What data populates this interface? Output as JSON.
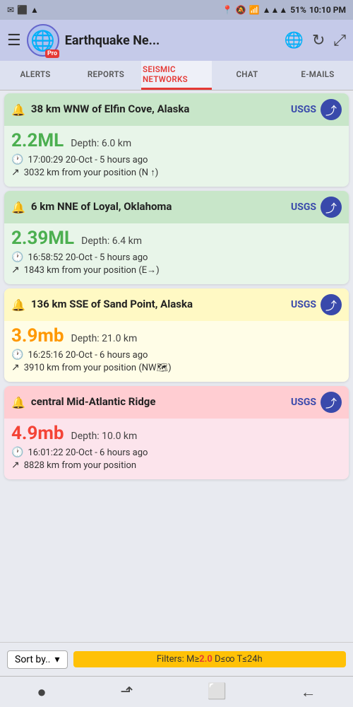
{
  "statusBar": {
    "leftIcons": [
      "✉",
      "⬛",
      "▲"
    ],
    "signal": "▲▲▲",
    "battery": "51%",
    "time": "10:10 PM"
  },
  "header": {
    "menuIcon": "☰",
    "appName": "Earthquake Ne...",
    "proBadge": "Pro",
    "globeIcon": "🌐",
    "refreshIcon": "↻",
    "expandIcon": "⤢"
  },
  "tabs": [
    {
      "id": "alerts",
      "label": "ALERTS",
      "active": false
    },
    {
      "id": "reports",
      "label": "REPORTS",
      "active": false
    },
    {
      "id": "seismic",
      "label": "SEISMIC NETWORKS",
      "active": true
    },
    {
      "id": "chat",
      "label": "CHAT",
      "active": false
    },
    {
      "id": "emails",
      "label": "E-MAILS",
      "active": false
    }
  ],
  "earthquakes": [
    {
      "id": "eq1",
      "location": "38 km WNW of Elfin Cove, Alaska",
      "source": "USGS",
      "magnitude": "2.2ML",
      "magnitudeClass": "mag-green",
      "depth": "Depth: 6.0 km",
      "time": "17:00:29 20-Oct - 5 hours ago",
      "distance": "3032 km from your position (N ↑)",
      "cardClass": "card-green",
      "headerClass": "card-header-green"
    },
    {
      "id": "eq2",
      "location": "6 km NNE of Loyal, Oklahoma",
      "source": "USGS",
      "magnitude": "2.39ML",
      "magnitudeClass": "mag-green",
      "depth": "Depth: 6.4 km",
      "time": "16:58:52 20-Oct - 5 hours ago",
      "distance": "1843 km from your position (E→)",
      "cardClass": "card-green",
      "headerClass": "card-header-green"
    },
    {
      "id": "eq3",
      "location": "136 km SSE of Sand Point, Alaska",
      "source": "USGS",
      "magnitude": "3.9mb",
      "magnitudeClass": "mag-orange",
      "depth": "Depth: 21.0 km",
      "time": "16:25:16 20-Oct - 6 hours ago",
      "distance": "3910 km from your position (NW🗺)",
      "cardClass": "card-yellow",
      "headerClass": "card-header-yellow"
    },
    {
      "id": "eq4",
      "location": "central Mid-Atlantic Ridge",
      "source": "USGS",
      "magnitude": "4.9mb",
      "magnitudeClass": "mag-red",
      "depth": "Depth: 10.0 km",
      "time": "16:01:22 20-Oct - 6 hours ago",
      "distance": "8828 km from your position",
      "cardClass": "card-pink",
      "headerClass": "card-header-pink"
    }
  ],
  "sortBar": {
    "label": "Sort by..",
    "chevron": "▾",
    "filterLabel": "Filters: M≥",
    "filterMag": "2.0",
    "filterRest": " D≤∞ T≤24h"
  },
  "bottomNav": {
    "icons": [
      "●",
      "⬏",
      "⬜",
      "←"
    ]
  }
}
